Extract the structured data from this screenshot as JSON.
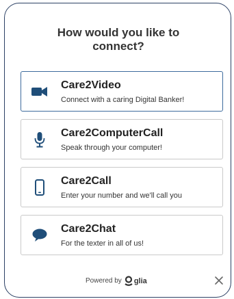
{
  "dialog": {
    "title_line1": "How would you like to",
    "title_line2": "connect?"
  },
  "options": [
    {
      "title": "Care2Video",
      "subtitle": "Connect with a caring Digital Banker!",
      "icon": "video-camera-icon",
      "selected": true
    },
    {
      "title": "Care2ComputerCall",
      "subtitle": "Speak through your computer!",
      "icon": "microphone-icon",
      "selected": false
    },
    {
      "title": "Care2Call",
      "subtitle": "Enter your number and we'll call you",
      "icon": "mobile-phone-icon",
      "selected": false
    },
    {
      "title": "Care2Chat",
      "subtitle": "For the texter in all of us!",
      "icon": "chat-bubble-icon",
      "selected": false
    }
  ],
  "footer": {
    "powered_by": "Powered by",
    "brand": "glia",
    "close_icon": "close-icon"
  },
  "colors": {
    "accent": "#1f4e79",
    "border": "#c9c9c9",
    "panel_border": "#2a3f63"
  }
}
